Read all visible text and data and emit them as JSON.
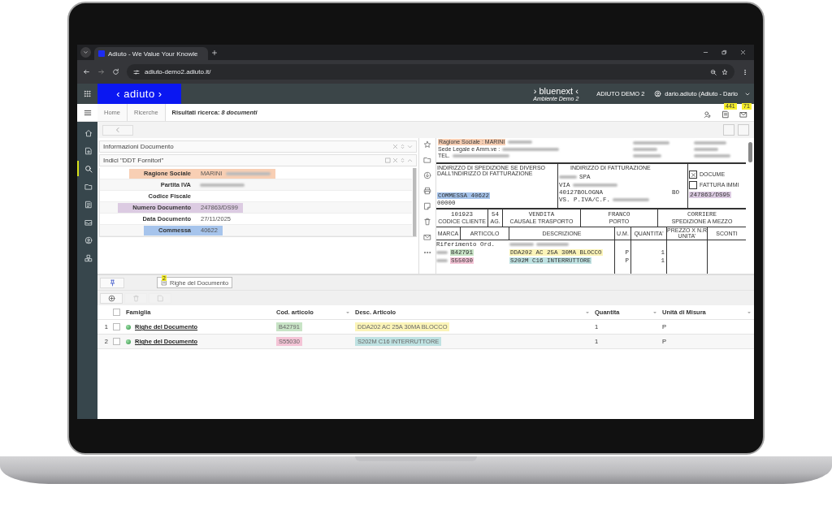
{
  "browser": {
    "tab_title": "Adiuto - We Value Your Knowle",
    "url": "adiuto-demo2.adiuto.it/"
  },
  "header": {
    "logo": "‹ adiuto ›",
    "brand": "› bluenext ‹",
    "brand_sub": "Ambiente Demo 2",
    "environment": "ADIUTO DEMO 2",
    "user": "dario.adiuto (Adiuto - Dario"
  },
  "breadcrumb": [
    {
      "label": "Home"
    },
    {
      "label": "Ricerche"
    },
    {
      "label": "Risultati ricerca: *8 documenti*"
    }
  ],
  "top_actions": [
    {
      "kind": "key"
    },
    {
      "kind": "document",
      "badge": "441"
    },
    {
      "kind": "mail",
      "badge": "71"
    }
  ],
  "sidebar": [
    {
      "kind": "home",
      "selected": false
    },
    {
      "kind": "new",
      "selected": false
    },
    {
      "kind": "search",
      "selected": true
    },
    {
      "kind": "folder",
      "selected": false
    },
    {
      "kind": "report",
      "selected": false
    },
    {
      "kind": "inbox",
      "selected": false
    },
    {
      "kind": "user",
      "selected": false
    },
    {
      "kind": "cubes",
      "selected": false
    }
  ],
  "info_panel": {
    "title": "Informazioni Documento"
  },
  "index_panel": {
    "title": "Indici \"DDT Fornitori\"",
    "fields": [
      {
        "label": "Ragione Sociale",
        "value": "MARINI",
        "redacted": true,
        "color": "#f8cfb4"
      },
      {
        "label": "Partita IVA",
        "redacted": true
      },
      {
        "label": "Codice Fiscale",
        "redacted": false
      },
      {
        "label": "Numero Documento",
        "value": "247863/DS99",
        "redacted": false,
        "color": "#dccbe2"
      },
      {
        "label": "Data Documento",
        "value": "27/11/2025",
        "redacted": false
      },
      {
        "label": "Commessa",
        "value": "40622",
        "redacted": false,
        "color": "#a6c4ec"
      }
    ]
  },
  "doc_tools": [
    {
      "kind": "star"
    },
    {
      "kind": "folder"
    },
    {
      "kind": "download"
    },
    {
      "kind": "print"
    },
    {
      "kind": "note"
    },
    {
      "kind": "trash"
    },
    {
      "kind": "mail"
    },
    {
      "kind": "more"
    }
  ],
  "document": {
    "header_lines": [
      {
        "text": "Ragione Sociale : MARINI",
        "color": "#f8cfb4"
      },
      {
        "text": "Sede Legale e Amm.ve :"
      },
      {
        "text": "TEL."
      }
    ],
    "shipping": {
      "title": "INDIRIZZO DI SPEDIZIONE SE DIVERSO DALL'INDIRIZZO DI FATTURAZIONE",
      "lines": [
        {
          "text": "COMMESSA 40622",
          "color": "#a6c4ec"
        },
        {
          "text": "00000"
        }
      ]
    },
    "billing": {
      "title": "INDIRIZZO DI FATTURAZIONE",
      "lines": [
        {
          "text": "SPA"
        },
        {
          "text": "VIA"
        },
        {
          "text": "40127BOLOGNA"
        },
        {
          "text": "VS. P.IVA/C.F."
        }
      ],
      "province": "BO"
    },
    "doc_type": {
      "options": [
        {
          "label": "DOCUME",
          "checked": true
        },
        {
          "label": "FATTURA IMMI",
          "checked": false
        }
      ],
      "number": {
        "text": "247863/DS95",
        "color": "#dccbe2"
      }
    },
    "transport": [
      {
        "value": "101923",
        "label": "CODICE CLIENTE"
      },
      {
        "value": "54",
        "label": "AG."
      },
      {
        "value": "VENDITA",
        "label": "CAUSALE TRASPORTO"
      },
      {
        "value": "FRANCO",
        "label": "PORTO"
      },
      {
        "value": "CORRIERE",
        "label": "SPEDIZIONE A MEZZO"
      }
    ],
    "columns": [
      "MARCA",
      "ARTICOLO",
      "DESCRIZIONE",
      "U.M.",
      "QUANTITA'",
      "PREZZO X N.R UNITA'",
      "SCONTI"
    ],
    "reference": "Riferimento Ord.",
    "lines": [
      {
        "code": {
          "text": "B42791",
          "color": "#c8e4c6"
        },
        "description": {
          "text": "DDA202 AC 25A 30MA BLOCCO",
          "color": "#fbf4b8"
        },
        "unit": "P",
        "quantity": "1"
      },
      {
        "code": {
          "text": "S55030",
          "color": "#f4c4d6"
        },
        "description": {
          "text": "S202M C16 INTERRUTTORE",
          "color": "#bfe2e2"
        },
        "unit": "P",
        "quantity": "1"
      }
    ]
  },
  "bottom": {
    "tabs": [
      {
        "label": "Righe del Documento",
        "badge": "2",
        "selected": true
      }
    ],
    "toolbar": [
      {
        "kind": "add",
        "disabled": false
      },
      {
        "kind": "delete",
        "disabled": true
      },
      {
        "kind": "edit",
        "disabled": true
      }
    ],
    "table": {
      "select_all_checked": false,
      "columns": [
        {
          "label": "Famiglia",
          "filter": false
        },
        {
          "label": "Cod. articolo",
          "filter": true
        },
        {
          "label": "Desc. Articolo",
          "filter": true
        },
        {
          "label": "Quantita",
          "filter": true
        },
        {
          "label": "Unità di Misura",
          "filter": true
        }
      ],
      "rows": [
        {
          "index": "1",
          "checked": false,
          "family": "Righe del Documento",
          "code": {
            "text": "B42791",
            "color": "#c8e4c6"
          },
          "description": {
            "text": "DDA202 AC 25A 30MA BLOCCO",
            "color": "#fbf4b8"
          },
          "quantity": "1",
          "unit": "P"
        },
        {
          "index": "2",
          "checked": false,
          "family": "Righe del Documento",
          "code": {
            "text": "S55030",
            "color": "#f4c4d6"
          },
          "description": {
            "text": "S202M C16 INTERRUTTORE",
            "color": "#bfe2e2"
          },
          "quantity": "1",
          "unit": "P"
        }
      ]
    }
  }
}
